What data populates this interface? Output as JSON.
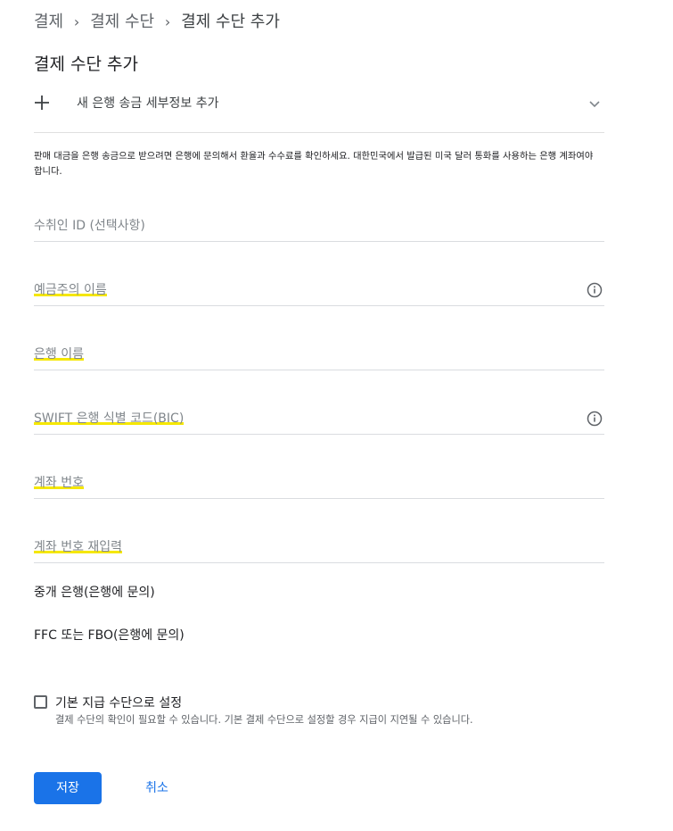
{
  "breadcrumb": {
    "items": [
      "결제",
      "결제 수단",
      "결제 수단 추가"
    ],
    "separator": "›"
  },
  "page_title": "결제 수단 추가",
  "add_bank": {
    "icon": "plus-icon",
    "label": "새 은행 송금 세부정보 추가",
    "expand_icon": "chevron-down-icon"
  },
  "notice": "판매 대금을 은행 송금으로 받으려면 은행에 문의해서 환율과 수수료를 확인하세요. 대한민국에서 발급된 미국 달러 통화를 사용하는 은행 계좌여야 합니다.",
  "fields": {
    "payee_id": {
      "placeholder": "수취인 ID (선택사항)"
    },
    "account_holder": {
      "placeholder": "예금주의 이름",
      "icon": "info-icon"
    },
    "bank_name": {
      "placeholder": "은행 이름"
    },
    "swift": {
      "placeholder": "SWIFT 은행 식별 코드(BIC)",
      "icon": "info-icon"
    },
    "account_number": {
      "placeholder": "계좌 번호"
    },
    "account_number_confirm": {
      "placeholder": "계좌 번호 재입력"
    }
  },
  "intermediary_bank": "중개 은행(은행에 문의)",
  "ffc": "FFC 또는 FBO(은행에 문의)",
  "default_payment": {
    "checked": false,
    "label": "기본 지급 수단으로 설정",
    "note": "결제 수단의 확인이 필요할 수 있습니다. 기본 결제 수단으로 설정할 경우 지급이 지연될 수 있습니다."
  },
  "actions": {
    "save": "저장",
    "cancel": "취소"
  },
  "colors": {
    "primary": "#1a73e8",
    "highlight": "#f5e700",
    "text_secondary": "#80868b"
  }
}
